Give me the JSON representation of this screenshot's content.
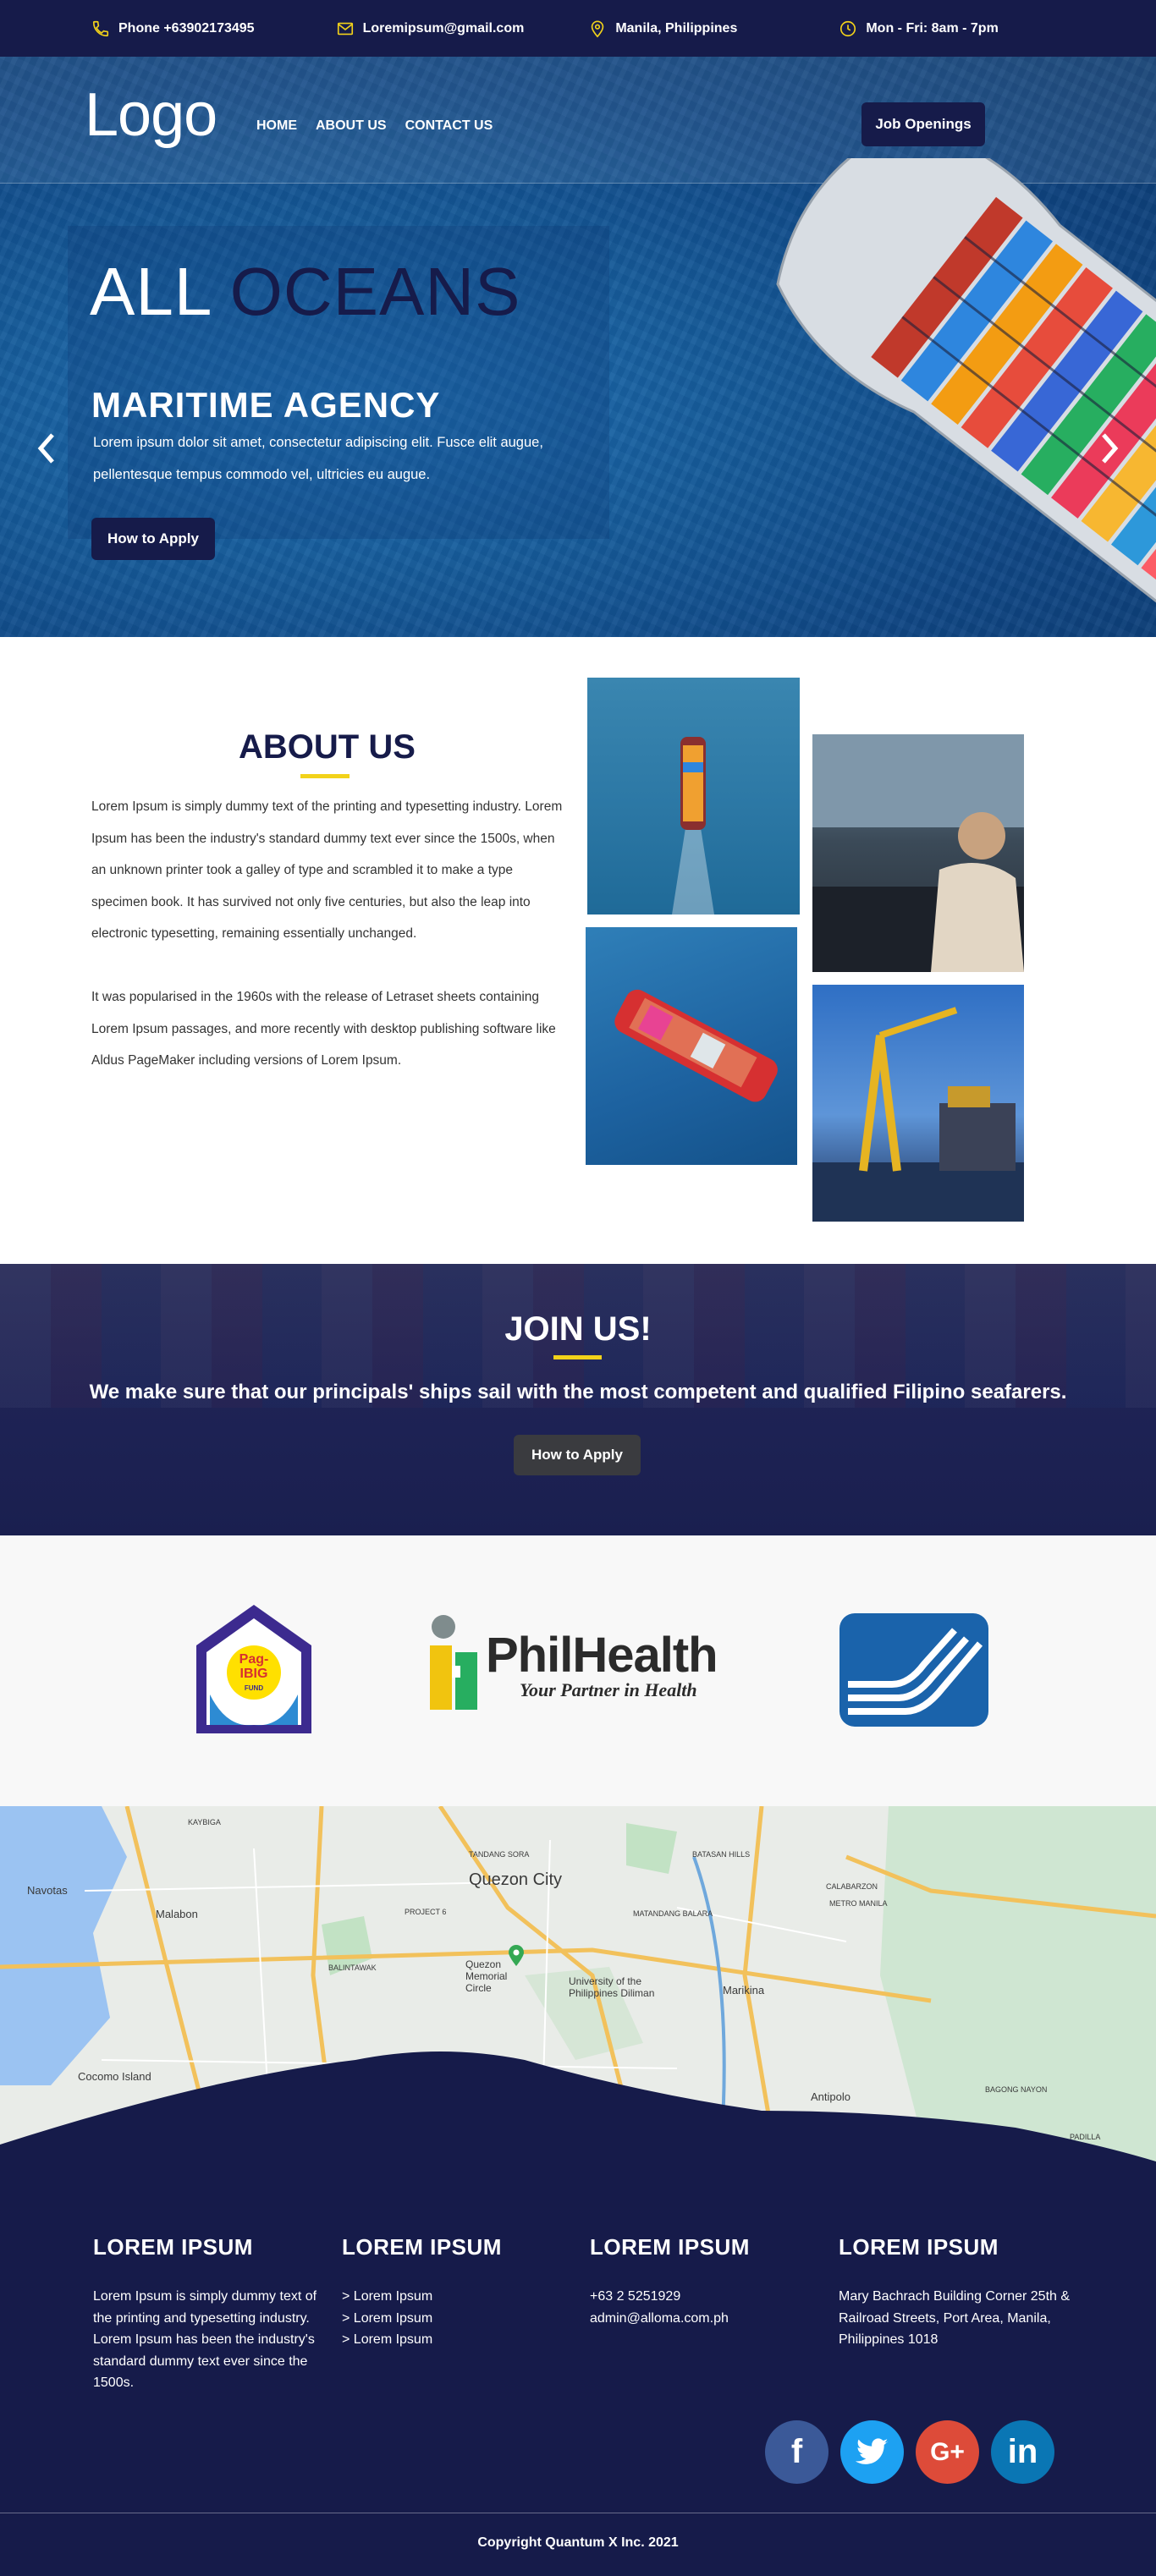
{
  "topbar": {
    "phone": "Phone +63902173495",
    "email": "Loremipsum@gmail.com",
    "location": "Manila, Philippines",
    "hours": "Mon - Fri: 8am - 7pm"
  },
  "header": {
    "logo": "Logo",
    "nav": [
      "HOME",
      "ABOUT US",
      "CONTACT US"
    ],
    "job_button": "Job Openings"
  },
  "hero": {
    "title_part1": "ALL ",
    "title_part2": "OCEANS",
    "subtitle": "MARITIME AGENCY",
    "description": "Lorem ipsum dolor sit amet, consectetur adipiscing elit. Fusce elit augue, pellentesque tempus commodo vel, ultricies eu augue.",
    "button": "How to Apply",
    "slides": 3,
    "active_slide": 1
  },
  "about": {
    "title": "ABOUT US",
    "paragraph1": "Lorem Ipsum is simply dummy text of the printing and typesetting industry. Lorem Ipsum has been the industry's standard dummy text ever since the 1500s, when an unknown printer took a galley of type and scrambled it to make a type specimen book. It has survived not only five centuries, but also the leap into electronic typesetting, remaining essentially unchanged.",
    "paragraph2": "It was popularised in the 1960s with the release of Letraset sheets containing Lorem Ipsum passages, and more recently with desktop publishing software like Aldus PageMaker including versions of Lorem Ipsum."
  },
  "join": {
    "title": "JOIN US!",
    "subtitle": "We make sure that our principals' ships sail with the most competent and qualified Filipino seafarers.",
    "button": "How to Apply"
  },
  "partners": {
    "pagibig_line1": "Pag-",
    "pagibig_line2": "IBIG",
    "pagibig_line3": "FUND",
    "philhealth_name": "PhilHealth",
    "philhealth_tagline": "Your Partner in Health"
  },
  "map": {
    "labels": {
      "quezon_city": "Quezon City",
      "navotas": "Navotas",
      "malabon": "Malabon",
      "marikina": "Marikina",
      "antipolo": "Antipolo",
      "cocomo": "Cocomo Island",
      "tandang_sora": "TANDANG SORA",
      "batasan": "BATASAN HILLS",
      "matandang_balara": "MATANDANG BALARA",
      "project6": "PROJECT 6",
      "balintawak": "BALINTAWAK",
      "memorial": "Quezon Memorial Circle",
      "up_diliman": "University of the Philippines Diliman",
      "calabarzon": "CALABARZON",
      "metro_manila": "METRO MANILA",
      "bagong_nayon": "BAGONG NAYON",
      "padilla": "PADILLA",
      "kaybiga": "KAYBIGA"
    }
  },
  "footer": {
    "col1_title": "LOREM IPSUM",
    "col1_text": "Lorem Ipsum is simply dummy text of the printing and typesetting industry. Lorem Ipsum has been the industry's standard dummy text ever since the 1500s.",
    "col2_title": "LOREM IPSUM",
    "col2_links": [
      "> Lorem Ipsum",
      "> Lorem Ipsum",
      "> Lorem Ipsum"
    ],
    "col3_title": "LOREM IPSUM",
    "col3_phone": "+63 2 5251929",
    "col3_email": "admin@alloma.com.ph",
    "col4_title": "LOREM IPSUM",
    "col4_address": "Mary Bachrach Building Corner 25th & Railroad Streets, Port Area, Manila, Philippines 1018",
    "social": [
      "f",
      "t",
      "G+",
      "in"
    ],
    "copyright": "Copyright  Quantum X Inc. 2021"
  }
}
